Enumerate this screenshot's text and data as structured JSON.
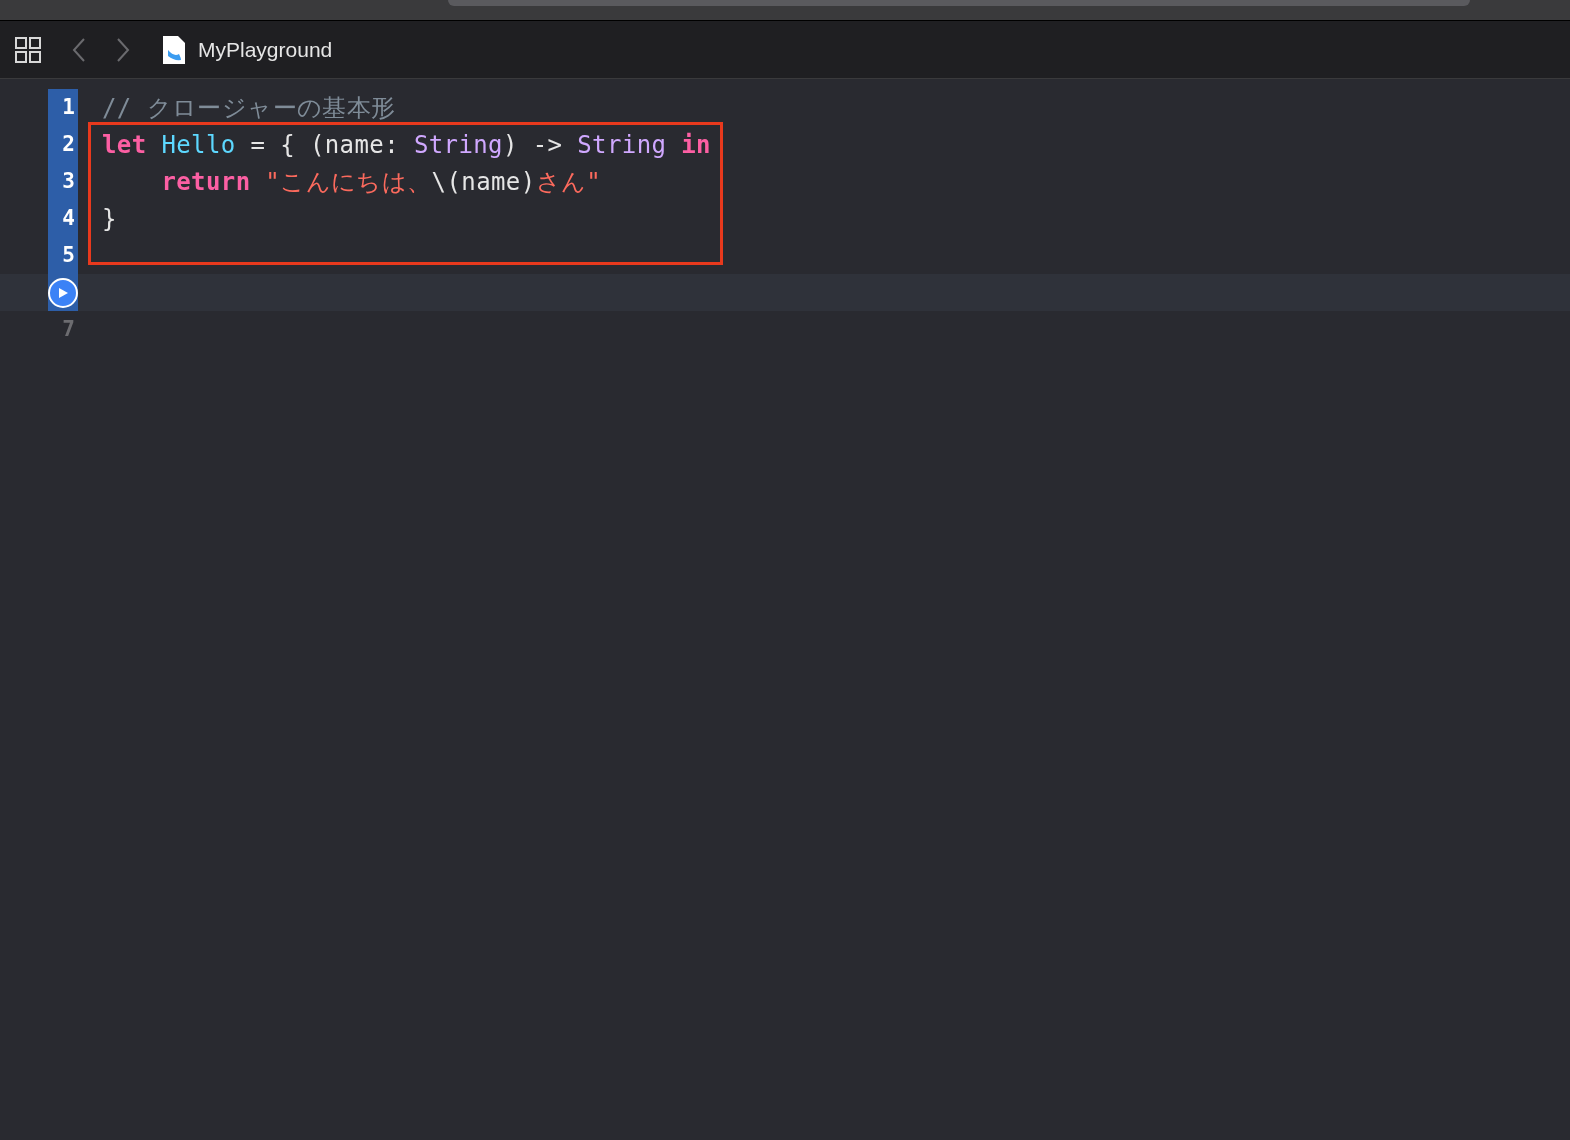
{
  "toolbar": {
    "title": "MyPlayground"
  },
  "sections": [
    {
      "kind": "plain",
      "lines": [
        {
          "kind": "number",
          "number": "1",
          "executed": true,
          "tokens": [
            {
              "kind": "comment",
              "text": "// クロージャーの基本形"
            }
          ]
        }
      ]
    },
    {
      "kind": "framed",
      "lines": [
        {
          "kind": "number",
          "number": "2",
          "executed": true,
          "tokens": [
            {
              "kind": "keyword",
              "text": "let"
            },
            {
              "kind": "decl",
              "text": " Hello"
            },
            {
              "kind": "plain",
              "text": " = { (name: "
            },
            {
              "kind": "type",
              "text": "String"
            },
            {
              "kind": "plain",
              "text": ") -> "
            },
            {
              "kind": "type",
              "text": "String"
            },
            {
              "kind": "keyword",
              "text": " in"
            }
          ]
        },
        {
          "kind": "number",
          "number": "3",
          "executed": true,
          "tokens": [
            {
              "kind": "keyword",
              "text": "    return"
            },
            {
              "kind": "string",
              "text": " \"こんにちは、"
            },
            {
              "kind": "plain",
              "text": "\\(name)"
            },
            {
              "kind": "string",
              "text": "さん\""
            }
          ]
        },
        {
          "kind": "number",
          "number": "4",
          "executed": true,
          "tokens": [
            {
              "kind": "plain",
              "text": "}"
            }
          ]
        }
      ]
    },
    {
      "kind": "plain",
      "lines": [
        {
          "kind": "number",
          "number": "5",
          "executed": true
        },
        {
          "kind": "run",
          "executed": true
        },
        {
          "kind": "number",
          "number": "7",
          "executed": false
        }
      ]
    }
  ]
}
